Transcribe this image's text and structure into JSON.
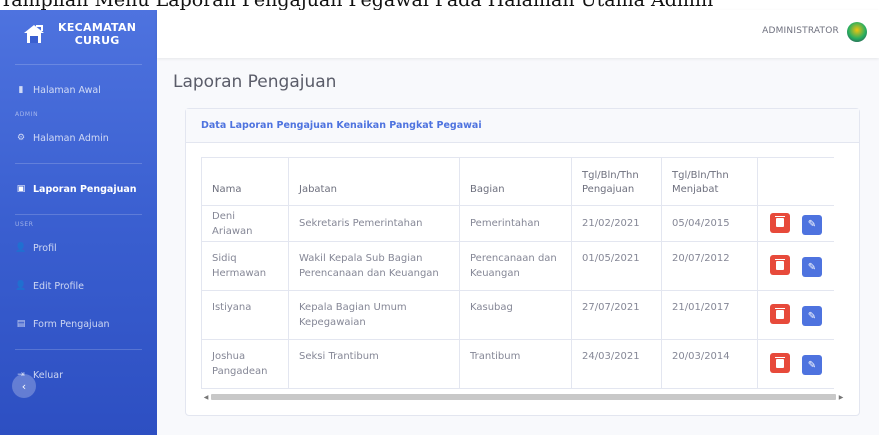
{
  "caption": "Tampilan Menu Laporan Pengajuan Pegawai Pada Halaman Utama Admin",
  "brand": {
    "line1": "KECAMATAN",
    "line2": "CURUG"
  },
  "sidebar": {
    "items": [
      {
        "label": "Halaman Awal",
        "icon": "home-icon",
        "glyph": "▮"
      },
      {
        "label": "Halaman Admin",
        "icon": "gear-icon",
        "glyph": "⚙"
      },
      {
        "label": "Laporan Pengajuan",
        "icon": "report-icon",
        "glyph": "▣"
      },
      {
        "label": "Profil",
        "icon": "user-icon",
        "glyph": "👤"
      },
      {
        "label": "Edit Profile",
        "icon": "user-edit-icon",
        "glyph": "👤"
      },
      {
        "label": "Form Pengajuan",
        "icon": "form-icon",
        "glyph": "▤"
      },
      {
        "label": "Keluar",
        "icon": "logout-icon",
        "glyph": "⇥"
      }
    ],
    "headings": {
      "admin": "ADMIN",
      "user": "USER"
    },
    "toggle": "‹"
  },
  "topbar": {
    "user": "ADMINISTRATOR"
  },
  "page": {
    "title": "Laporan Pengajuan"
  },
  "card": {
    "header": "Data Laporan Pengajuan Kenaikan Pangkat Pegawai",
    "columns": [
      "Nama",
      "Jabatan",
      "Bagian",
      "Tgl/Bln/Thn Pengajuan",
      "Tgl/Bln/Thn Menjabat"
    ],
    "rows": [
      {
        "nama": "Deni Ariawan",
        "jabatan": "Sekretaris Pemerintahan",
        "bagian": "Pemerintahan",
        "pengajuan": "21/02/2021",
        "menjabat": "05/04/2015"
      },
      {
        "nama": "Sidiq Hermawan",
        "jabatan": "Wakil Kepala Sub Bagian Perencanaan dan Keuangan",
        "bagian": "Perencanaan dan Keuangan",
        "pengajuan": "01/05/2021",
        "menjabat": "20/07/2012"
      },
      {
        "nama": "Istiyana",
        "jabatan": "Kepala Bagian Umum Kepegawaian",
        "bagian": "Kasubag",
        "pengajuan": "27/07/2021",
        "menjabat": "21/01/2017"
      },
      {
        "nama": "Joshua Pangadean",
        "jabatan": "Seksi Trantibum",
        "bagian": "Trantibum",
        "pengajuan": "24/03/2021",
        "menjabat": "20/03/2014"
      }
    ]
  },
  "colors": {
    "primary": "#4e73df",
    "danger": "#e74a3b",
    "background": "#f8f9fc"
  }
}
